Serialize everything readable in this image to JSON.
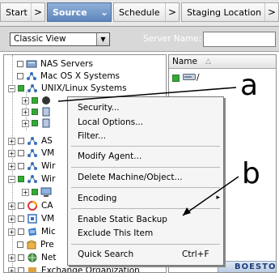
{
  "wizard_tabs": [
    {
      "label": "Start"
    },
    {
      "label": "Source",
      "active": true
    },
    {
      "label": "Schedule"
    },
    {
      "label": "Staging Location"
    }
  ],
  "view": {
    "selected": "Classic View",
    "server_label": "Server Name:",
    "server_value": ""
  },
  "tree": {
    "items": [
      {
        "label": "NAS Servers"
      },
      {
        "label": "Mac OS X Systems"
      },
      {
        "label": "UNIX/Linux Systems"
      },
      {
        "label": "AS"
      },
      {
        "label": "VM"
      },
      {
        "label": "Wir"
      },
      {
        "label": "Wir"
      },
      {
        "label": "CA"
      },
      {
        "label": "VM"
      },
      {
        "label": "Mic"
      },
      {
        "label": "Pre"
      },
      {
        "label": "Net"
      },
      {
        "label": "Exchange Organization"
      }
    ]
  },
  "list": {
    "column_name": "Name",
    "sort_glyph": "△",
    "rows": [
      {
        "label": "/"
      }
    ],
    "banner": "BOESTO"
  },
  "context_menu": {
    "items": [
      {
        "label": "Security..."
      },
      {
        "label": "Local Options..."
      },
      {
        "label": "Filter..."
      },
      {
        "label": "Modify Agent..."
      },
      {
        "label": "Delete Machine/Object..."
      },
      {
        "label": "Encoding",
        "submenu": "▸"
      },
      {
        "label": "Enable Static Backup"
      },
      {
        "label": "Exclude This Item"
      },
      {
        "label": "Quick Search",
        "shortcut": "Ctrl+F"
      }
    ]
  },
  "annotations": {
    "a": "a",
    "b": "b"
  },
  "colors": {
    "active_tab": "#6a8fc4",
    "checked_green": "#33aa33",
    "menu_bg": "#f5f5f5"
  }
}
